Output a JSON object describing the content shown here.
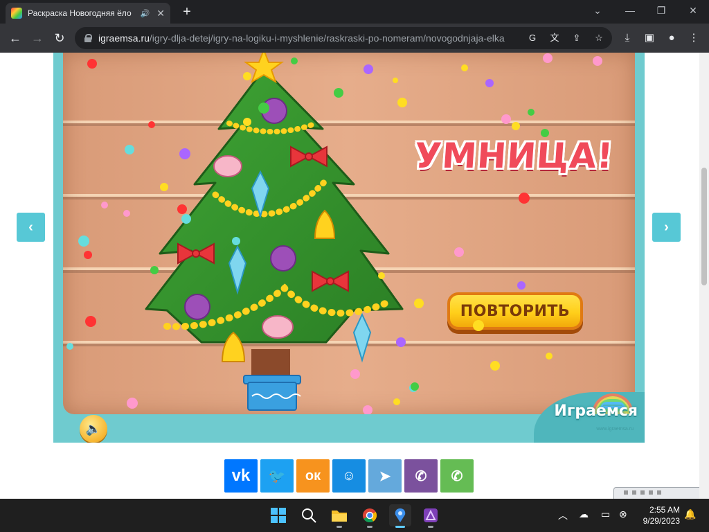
{
  "browser": {
    "tab_title": "Раскраска Новогодняя ёло",
    "tab_audio_icon": "speaker-icon",
    "new_tab_label": "+",
    "url_host": "igraemsa.ru",
    "url_path": "/igry-dlja-detej/igry-na-logiku-i-myshlenie/raskraski-po-nomeram/novogodnjaja-elka"
  },
  "game": {
    "victory_text": "УМНИЦА!",
    "repeat_label": "ПОВТОРИТЬ",
    "brand_name": "Играемся",
    "brand_url": "www.igraemsa.ru",
    "prev_label": "‹",
    "next_label": "›"
  },
  "share": [
    {
      "name": "vk",
      "label": "vk",
      "color": "#0077ff"
    },
    {
      "name": "twitter",
      "label": "🐦",
      "color": "#1da1f2"
    },
    {
      "name": "odnoklassniki",
      "label": "ок",
      "color": "#f7931e"
    },
    {
      "name": "moimir",
      "label": "☺",
      "color": "#168de2"
    },
    {
      "name": "telegram",
      "label": "➤",
      "color": "#64a9dc"
    },
    {
      "name": "viber",
      "label": "✆",
      "color": "#7b519d"
    },
    {
      "name": "whatsapp",
      "label": "✆",
      "color": "#65bc54"
    }
  ],
  "taskbar": {
    "time": "2:55 AM",
    "date": "9/29/2023"
  }
}
